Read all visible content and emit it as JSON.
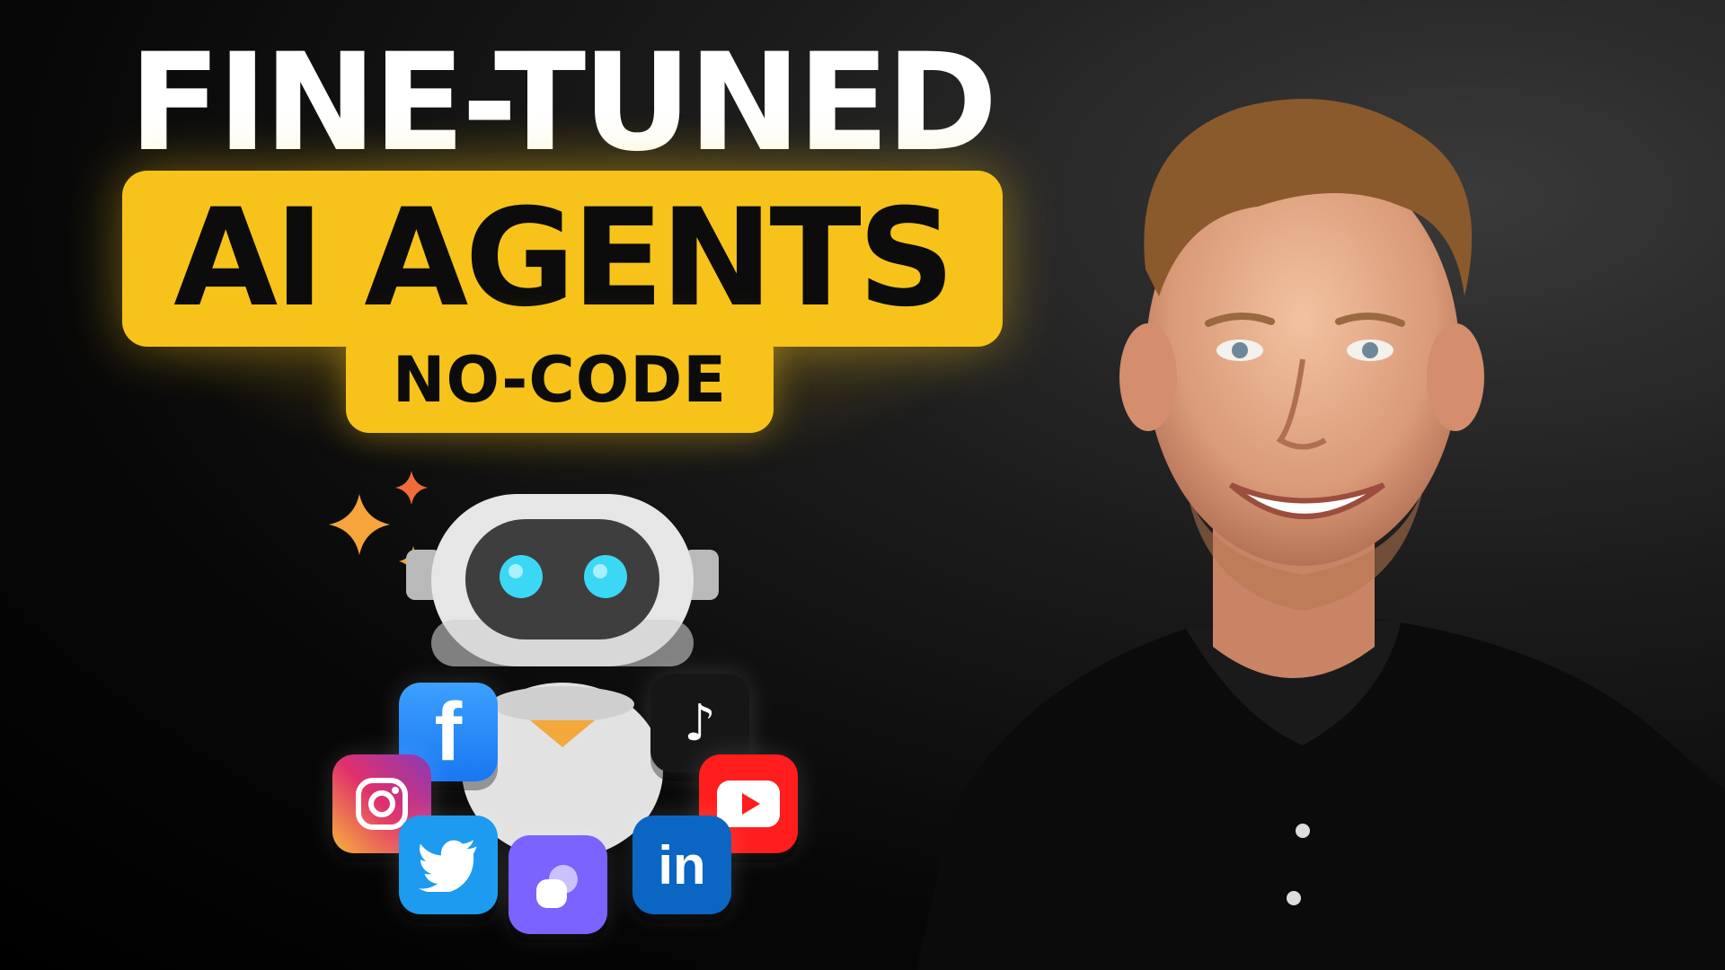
{
  "headline": {
    "line1": "FINE-TUNED",
    "line2": "AI AGENTS",
    "tag": "NO-CODE"
  },
  "colors": {
    "accent": "#f7c31a",
    "background": "#0a0a0a",
    "text": "#ffffff"
  },
  "icons": {
    "facebook": "f",
    "tiktok": "♪",
    "linkedin": "in"
  }
}
